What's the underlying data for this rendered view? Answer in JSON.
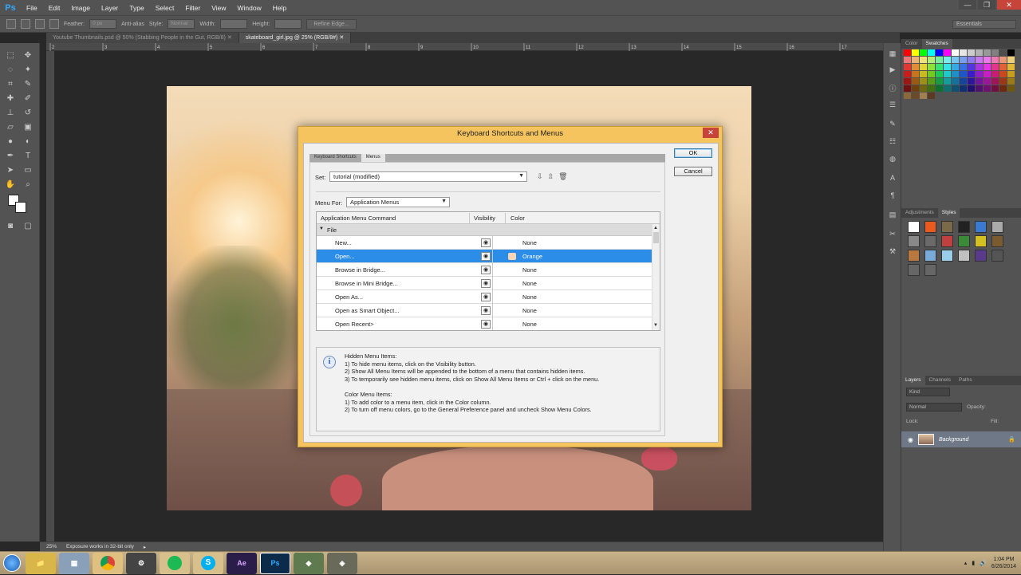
{
  "app": {
    "logo": "Ps",
    "menu": [
      "File",
      "Edit",
      "Image",
      "Layer",
      "Type",
      "Select",
      "Filter",
      "View",
      "Window",
      "Help"
    ],
    "window_controls": [
      "—",
      "❐",
      "✕"
    ]
  },
  "options": {
    "feather_label": "Feather:",
    "feather_value": "0 px",
    "antialias_label": "Anti-alias",
    "style_label": "Style:",
    "style_value": "Normal",
    "width_label": "Width:",
    "height_label": "Height:",
    "refine_edge": "Refine Edge...",
    "workspace": "Essentials"
  },
  "tabs": [
    {
      "label": "Youtube Thumbnails.psd @ 50% (Stabbing People in the Gut, RGB/8)",
      "close": "✕"
    },
    {
      "label": "skateboard_girl.jpg @ 25% (RGB/8#)",
      "close": "✕"
    }
  ],
  "ruler_ticks": [
    "2",
    "3",
    "4",
    "5",
    "6",
    "7",
    "8",
    "9",
    "10",
    "11",
    "12",
    "13",
    "14",
    "15",
    "16",
    "17"
  ],
  "status": {
    "zoom": "25%",
    "message": "Exposure works in 32-bit only"
  },
  "panels": {
    "color_tabs": [
      "Color",
      "Swatches"
    ],
    "adjust_tabs": [
      "Adjustments",
      "Styles"
    ],
    "layer_tabs": [
      "Layers",
      "Channels",
      "Paths"
    ],
    "kind": "Kind",
    "blend": "Normal",
    "opacity_label": "Opacity:",
    "lock_label": "Lock:",
    "fill_label": "Fill:",
    "layer_name": "Background"
  },
  "dialog": {
    "title": "Keyboard Shortcuts and Menus",
    "close": "✕",
    "inner_tabs": [
      "Keyboard Shortcuts",
      "Menus"
    ],
    "set_label": "Set:",
    "set_value": "tutorial (modified)",
    "menu_for_label": "Menu For:",
    "menu_for_value": "Application Menus",
    "columns": [
      "Application Menu Command",
      "Visibility",
      "Color"
    ],
    "group": "File",
    "rows": [
      {
        "command": "New...",
        "color": "None",
        "selected": false
      },
      {
        "command": "Open...",
        "color": "Orange",
        "selected": true
      },
      {
        "command": "Browse in Bridge...",
        "color": "None",
        "selected": false
      },
      {
        "command": "Browse in Mini Bridge...",
        "color": "None",
        "selected": false
      },
      {
        "command": "Open As...",
        "color": "None",
        "selected": false
      },
      {
        "command": "Open as Smart Object...",
        "color": "None",
        "selected": false
      },
      {
        "command": "Open Recent>",
        "color": "None",
        "selected": false
      }
    ],
    "info_lines": [
      "Hidden Menu Items:",
      "1) To hide menu items, click on the Visibility button.",
      "2) Show All Menu Items will be appended to the bottom of a menu that contains hidden items.",
      "3) To temporarily see hidden menu items, click on Show All Menu Items or Ctrl + click on the menu.",
      "",
      "Color Menu Items:",
      "1) To add color to a menu item, click in the Color column.",
      "2) To turn off menu colors, go to the General Preference panel and uncheck Show Menu Colors."
    ],
    "ok": "OK",
    "cancel": "Cancel"
  },
  "taskbar": {
    "apps": [
      "explorer",
      "calculator",
      "chrome",
      "steam",
      "spotify",
      "skype",
      "after-effects",
      "photoshop",
      "app1",
      "app2"
    ],
    "time": "1:04 PM",
    "date": "6/26/2014"
  }
}
